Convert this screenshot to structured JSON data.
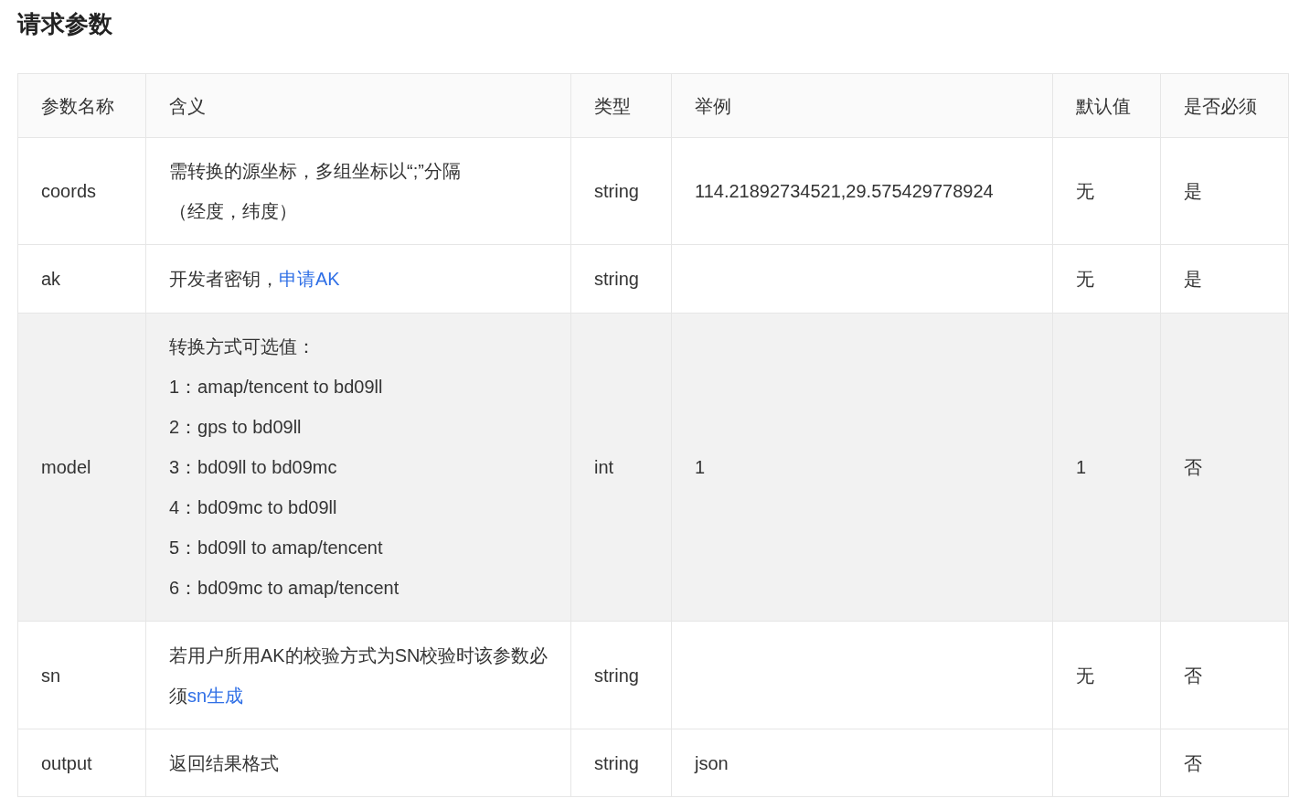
{
  "title": "请求参数",
  "table": {
    "columns": [
      "参数名称",
      "含义",
      "类型",
      "举例",
      "默认值",
      "是否必须"
    ],
    "rows": [
      {
        "name": "coords",
        "highlighted": false,
        "meaning": [
          [
            {
              "kind": "text",
              "text": "需转换的源坐标，多组坐标以“;”分隔"
            }
          ],
          [
            {
              "kind": "text",
              "text": "（经度，纬度）"
            }
          ]
        ],
        "type": "string",
        "example": "114.21892734521,29.575429778924",
        "default": "无",
        "required": "是"
      },
      {
        "name": "ak",
        "highlighted": false,
        "meaning": [
          [
            {
              "kind": "text",
              "text": "开发者密钥，"
            },
            {
              "kind": "link",
              "text": "申请AK"
            }
          ]
        ],
        "type": "string",
        "example": "",
        "default": "无",
        "required": "是"
      },
      {
        "name": "model",
        "highlighted": true,
        "meaning": [
          [
            {
              "kind": "text",
              "text": "转换方式可选值："
            }
          ],
          [
            {
              "kind": "text",
              "text": "1：amap/tencent to bd09ll"
            }
          ],
          [
            {
              "kind": "text",
              "text": "2：gps to bd09ll"
            }
          ],
          [
            {
              "kind": "text",
              "text": "3：bd09ll to bd09mc"
            }
          ],
          [
            {
              "kind": "text",
              "text": "4：bd09mc to bd09ll"
            }
          ],
          [
            {
              "kind": "text",
              "text": "5：bd09ll to amap/tencent"
            }
          ],
          [
            {
              "kind": "text",
              "text": "6：bd09mc to amap/tencent"
            }
          ]
        ],
        "type": "int",
        "example": "1",
        "default": "1",
        "required": "否"
      },
      {
        "name": "sn",
        "highlighted": false,
        "meaning": [
          [
            {
              "kind": "text",
              "text": "若用户所用AK的校验方式为SN校验时该参数必须"
            },
            {
              "kind": "link",
              "text": "sn生成"
            }
          ]
        ],
        "type": "string",
        "example": "",
        "default": "无",
        "required": "否"
      },
      {
        "name": "output",
        "highlighted": false,
        "meaning": [
          [
            {
              "kind": "text",
              "text": "返回结果格式"
            }
          ]
        ],
        "type": "string",
        "example": "json",
        "default": "",
        "required": "否"
      }
    ]
  }
}
